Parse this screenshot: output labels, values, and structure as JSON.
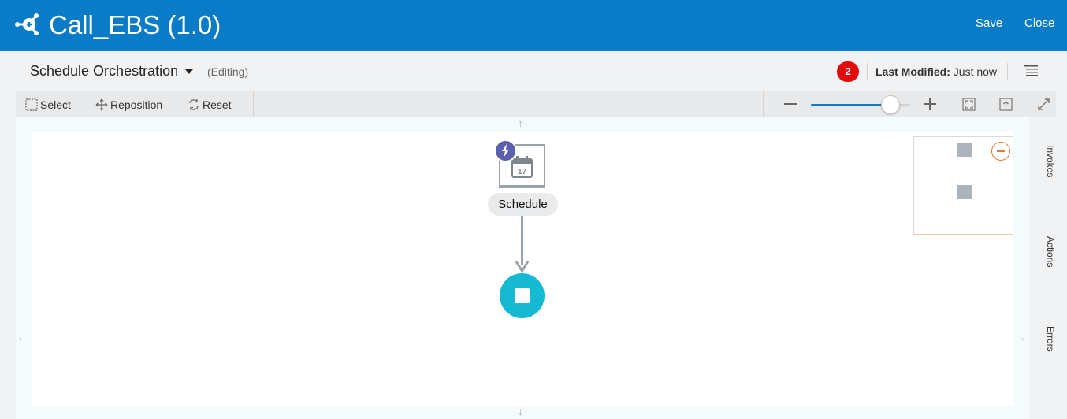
{
  "header": {
    "title": "Call_EBS (1.0)",
    "save_label": "Save",
    "close_label": "Close"
  },
  "subheader": {
    "orchestration_label": "Schedule Orchestration",
    "mode_label": "(Editing)",
    "badge_count": "2",
    "last_modified_label": "Last Modified:",
    "last_modified_value": "Just now"
  },
  "toolbar": {
    "select_label": "Select",
    "reposition_label": "Reposition",
    "reset_label": "Reset",
    "zoom_level": 0.8
  },
  "canvas": {
    "trigger_label": "Schedule",
    "calendar_day": "17"
  },
  "side_panel": {
    "tabs": [
      "Invokes",
      "Actions",
      "Errors"
    ]
  },
  "colors": {
    "header_bg": "#0a7bc6",
    "badge": "#e20a0a",
    "trigger_bolt": "#5d60ad",
    "end_node": "#15bad2"
  },
  "icons": [
    "app-logo-icon",
    "caret-down-icon",
    "menu-lines-icon",
    "select-icon",
    "reposition-icon",
    "reset-icon",
    "zoom-out-icon",
    "zoom-in-icon",
    "fit-icon",
    "export-icon",
    "expand-icon",
    "bolt-icon",
    "calendar-icon",
    "stop-icon"
  ]
}
